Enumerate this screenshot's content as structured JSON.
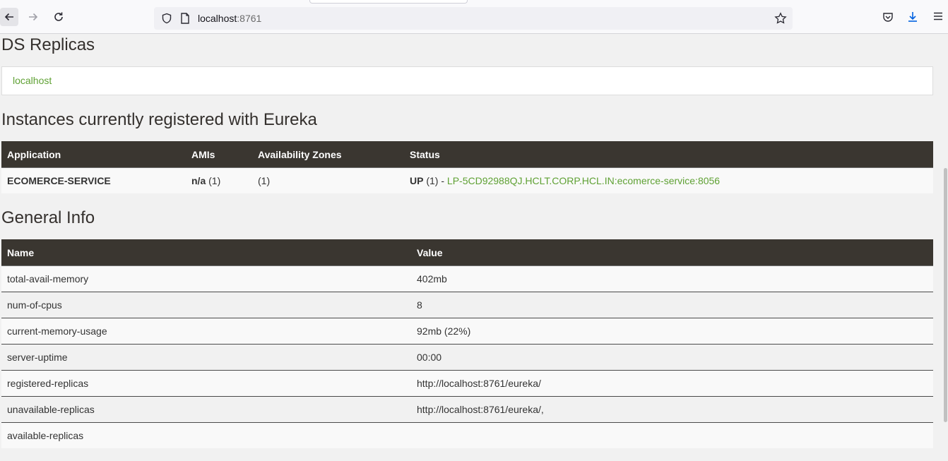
{
  "browser": {
    "url_host": "localhost",
    "url_port": ":8761",
    "icons": [
      "back-arrow-icon",
      "forward-arrow-icon",
      "reload-icon",
      "shield-icon",
      "page-icon",
      "bookmark-star-icon",
      "pocket-icon",
      "download-icon",
      "menu-icon"
    ]
  },
  "ds_replicas": {
    "heading": "DS Replicas",
    "replica": "localhost"
  },
  "instances": {
    "heading": "Instances currently registered with Eureka",
    "headers": [
      "Application",
      "AMIs",
      "Availability Zones",
      "Status"
    ],
    "rows": [
      {
        "application": "ECOMERCE-SERVICE",
        "ami_bold": "n/a",
        "ami_count": " (1)",
        "zones": "(1)",
        "status_bold": "UP",
        "status_count": " (1) - ",
        "status_link": "LP-5CD92988QJ.HCLT.CORP.HCL.IN:ecomerce-service:8056"
      }
    ]
  },
  "general_info": {
    "heading": "General Info",
    "headers": [
      "Name",
      "Value"
    ],
    "rows": [
      {
        "name": "total-avail-memory",
        "value": "402mb"
      },
      {
        "name": "num-of-cpus",
        "value": "8"
      },
      {
        "name": "current-memory-usage",
        "value": "92mb (22%)"
      },
      {
        "name": "server-uptime",
        "value": "00:00"
      },
      {
        "name": "registered-replicas",
        "value": "http://localhost:8761/eureka/"
      },
      {
        "name": "unavailable-replicas",
        "value": "http://localhost:8761/eureka/,"
      },
      {
        "name": "available-replicas",
        "value": ""
      }
    ]
  }
}
